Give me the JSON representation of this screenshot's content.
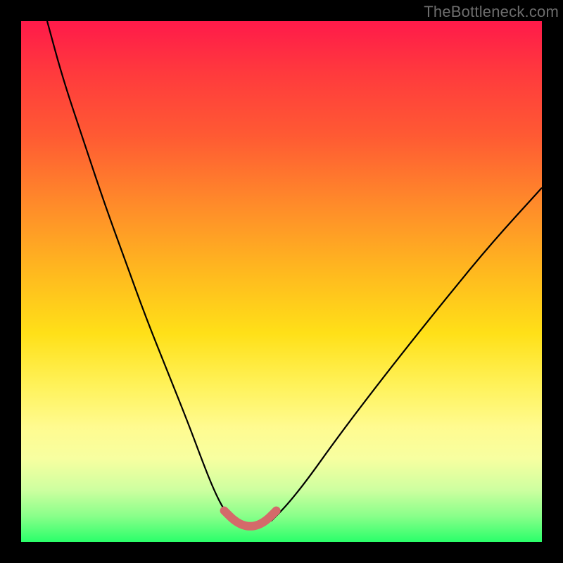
{
  "watermark": "TheBottleneck.com",
  "chart_data": {
    "type": "line",
    "title": "",
    "xlabel": "",
    "ylabel": "",
    "xlim": [
      0,
      100
    ],
    "ylim": [
      0,
      100
    ],
    "grid": false,
    "legend": false,
    "annotations": [],
    "series": [
      {
        "name": "left-branch",
        "stroke": "#000000",
        "width": 2.2,
        "x": [
          5,
          8,
          12,
          16,
          20,
          24,
          28,
          32,
          35,
          37,
          39,
          41
        ],
        "y": [
          100,
          89,
          77,
          65,
          54,
          43,
          33,
          23,
          15,
          10,
          6,
          4
        ]
      },
      {
        "name": "right-branch",
        "stroke": "#000000",
        "width": 2.2,
        "x": [
          48,
          51,
          55,
          60,
          66,
          73,
          81,
          90,
          100
        ],
        "y": [
          4,
          7,
          12,
          19,
          27,
          36,
          46,
          57,
          68
        ]
      },
      {
        "name": "valley-highlight",
        "stroke": "#d46a6a",
        "width": 12,
        "linecap": "round",
        "x": [
          39,
          41,
          43,
          45,
          47,
          49
        ],
        "y": [
          6,
          4,
          3,
          3,
          4,
          6
        ]
      }
    ],
    "background_gradient": {
      "direction": "top-to-bottom",
      "stops": [
        {
          "pos": 0,
          "color": "#ff1a4a"
        },
        {
          "pos": 50,
          "color": "#ffd21f"
        },
        {
          "pos": 100,
          "color": "#2aff6a"
        }
      ]
    }
  }
}
